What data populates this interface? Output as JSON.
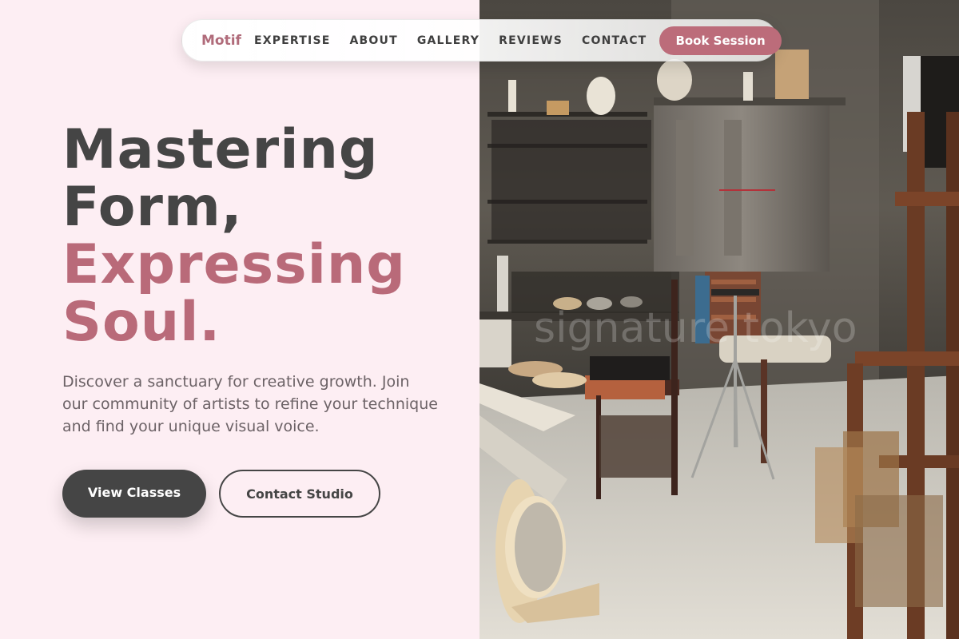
{
  "nav": {
    "brand": "Motif",
    "links": [
      "EXPERTISE",
      "ABOUT",
      "GALLERY",
      "REVIEWS",
      "CONTACT"
    ],
    "cta": "Book Session"
  },
  "hero": {
    "headline_line1": "Mastering",
    "headline_line2": "Form,",
    "headline_line3": "Expressing",
    "headline_line4": "Soul.",
    "description": "Discover a sanctuary for creative growth. Join our community of artists to refine your technique and find your unique visual voice.",
    "primary_button": "View Classes",
    "secondary_button": "Contact Studio"
  },
  "image": {
    "watermark": "signature tokyo",
    "alt": "pottery studio interior with kiln, chairs and shelves"
  },
  "colors": {
    "accent": "#b96a79",
    "dark": "#454545",
    "background": "#fdeef3",
    "cta": "#bc6c7a"
  }
}
